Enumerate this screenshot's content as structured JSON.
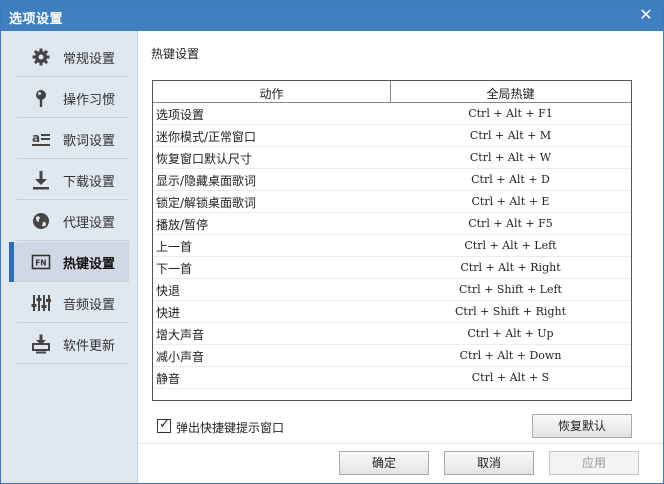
{
  "window": {
    "title": "选项设置",
    "close_glyph": "✕"
  },
  "sidebar": {
    "items": [
      {
        "label": "常规设置",
        "icon": "gear-icon"
      },
      {
        "label": "操作习惯",
        "icon": "pin-icon"
      },
      {
        "label": "歌词设置",
        "icon": "lyrics-icon"
      },
      {
        "label": "下载设置",
        "icon": "download-icon"
      },
      {
        "label": "代理设置",
        "icon": "globe-icon"
      },
      {
        "label": "热键设置",
        "icon": "fn-key-icon",
        "active": true
      },
      {
        "label": "音频设置",
        "icon": "equalizer-icon"
      },
      {
        "label": "软件更新",
        "icon": "update-icon"
      }
    ]
  },
  "content": {
    "section_title": "热键设置",
    "table": {
      "headers": {
        "action": "动作",
        "hotkey": "全局热键"
      },
      "rows": [
        {
          "action": "选项设置",
          "hotkey": "Ctrl + Alt + F1"
        },
        {
          "action": "迷你模式/正常窗口",
          "hotkey": "Ctrl + Alt + M"
        },
        {
          "action": "恢复窗口默认尺寸",
          "hotkey": "Ctrl + Alt + W"
        },
        {
          "action": "显示/隐藏桌面歌词",
          "hotkey": "Ctrl + Alt + D"
        },
        {
          "action": "锁定/解锁桌面歌词",
          "hotkey": "Ctrl + Alt + E"
        },
        {
          "action": "播放/暂停",
          "hotkey": "Ctrl + Alt + F5"
        },
        {
          "action": "上一首",
          "hotkey": "Ctrl + Alt + Left"
        },
        {
          "action": "下一首",
          "hotkey": "Ctrl + Alt + Right"
        },
        {
          "action": "快退",
          "hotkey": "Ctrl + Shift + Left"
        },
        {
          "action": "快进",
          "hotkey": "Ctrl + Shift + Right"
        },
        {
          "action": "增大声音",
          "hotkey": "Ctrl + Alt + Up"
        },
        {
          "action": "减小声音",
          "hotkey": "Ctrl + Alt + Down"
        },
        {
          "action": "静音",
          "hotkey": "Ctrl + Alt + S"
        }
      ]
    },
    "popup_checkbox": {
      "label": "弹出快捷键提示窗口",
      "checked": true,
      "check_glyph": "✓"
    },
    "restore_default_label": "恢复默认"
  },
  "footer": {
    "ok_label": "确定",
    "cancel_label": "取消",
    "apply_label": "应用"
  },
  "colors": {
    "titlebar": "#3f7fc0",
    "sidebar_bg": "#dfe7ef",
    "active_bar": "#2f6cb5"
  }
}
